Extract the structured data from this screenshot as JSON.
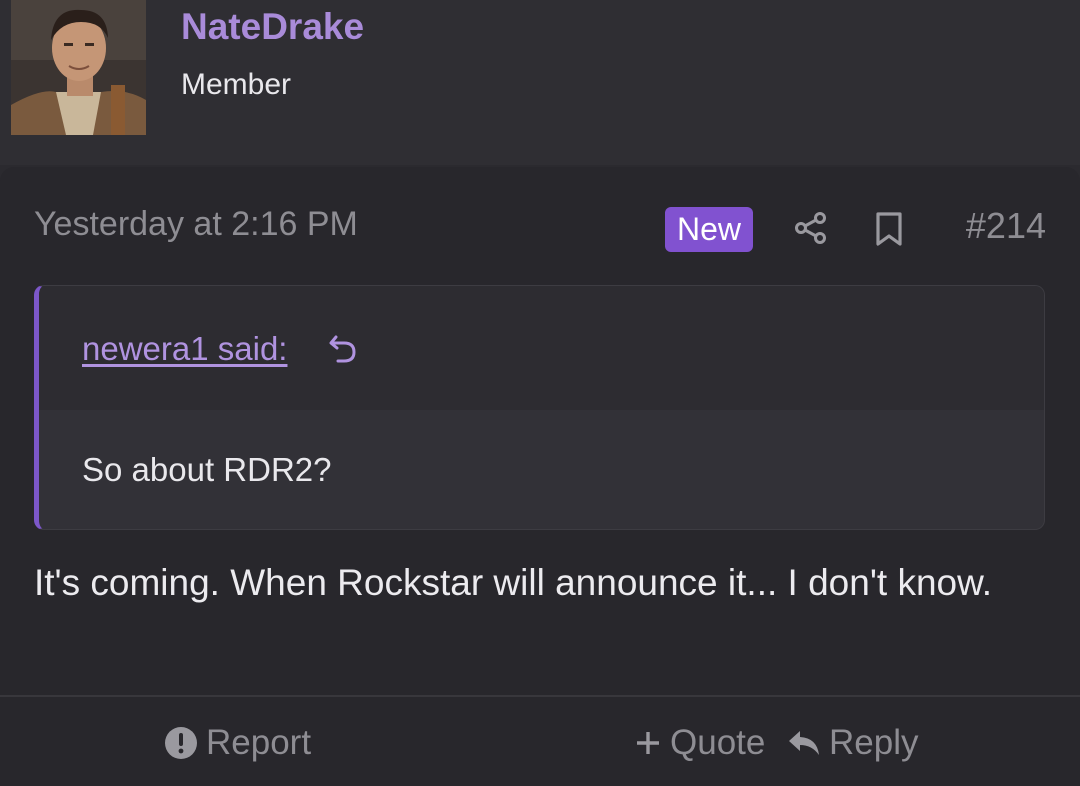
{
  "user": {
    "name": "NateDrake",
    "title": "Member"
  },
  "post": {
    "timestamp": "Yesterday at 2:16 PM",
    "badge": "New",
    "number": "#214",
    "quote": {
      "author_label": "newera1 said:",
      "text": "So about RDR2?"
    },
    "message": "It's coming. When Rockstar will announce it... I don't know."
  },
  "actions": {
    "report": "Report",
    "quote": "Quote",
    "reply": "Reply"
  },
  "colors": {
    "username": "#a98bd9",
    "badge": "#8152d0",
    "quote_border": "#7c57c9"
  }
}
